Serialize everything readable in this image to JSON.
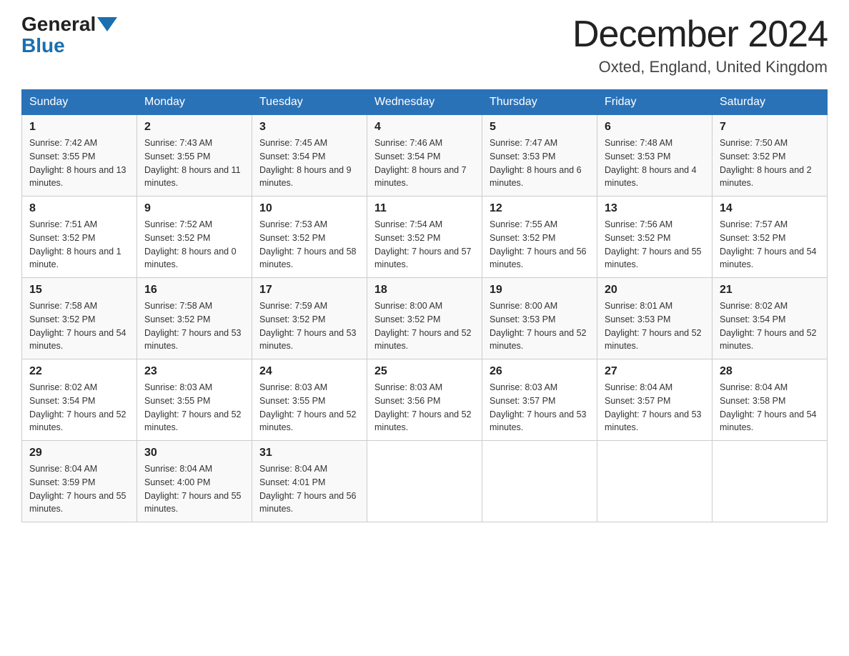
{
  "header": {
    "logo_general": "General",
    "logo_blue": "Blue",
    "month_title": "December 2024",
    "location": "Oxted, England, United Kingdom"
  },
  "days_of_week": [
    "Sunday",
    "Monday",
    "Tuesday",
    "Wednesday",
    "Thursday",
    "Friday",
    "Saturday"
  ],
  "weeks": [
    [
      {
        "day": "1",
        "sunrise": "7:42 AM",
        "sunset": "3:55 PM",
        "daylight": "8 hours and 13 minutes."
      },
      {
        "day": "2",
        "sunrise": "7:43 AM",
        "sunset": "3:55 PM",
        "daylight": "8 hours and 11 minutes."
      },
      {
        "day": "3",
        "sunrise": "7:45 AM",
        "sunset": "3:54 PM",
        "daylight": "8 hours and 9 minutes."
      },
      {
        "day": "4",
        "sunrise": "7:46 AM",
        "sunset": "3:54 PM",
        "daylight": "8 hours and 7 minutes."
      },
      {
        "day": "5",
        "sunrise": "7:47 AM",
        "sunset": "3:53 PM",
        "daylight": "8 hours and 6 minutes."
      },
      {
        "day": "6",
        "sunrise": "7:48 AM",
        "sunset": "3:53 PM",
        "daylight": "8 hours and 4 minutes."
      },
      {
        "day": "7",
        "sunrise": "7:50 AM",
        "sunset": "3:52 PM",
        "daylight": "8 hours and 2 minutes."
      }
    ],
    [
      {
        "day": "8",
        "sunrise": "7:51 AM",
        "sunset": "3:52 PM",
        "daylight": "8 hours and 1 minute."
      },
      {
        "day": "9",
        "sunrise": "7:52 AM",
        "sunset": "3:52 PM",
        "daylight": "8 hours and 0 minutes."
      },
      {
        "day": "10",
        "sunrise": "7:53 AM",
        "sunset": "3:52 PM",
        "daylight": "7 hours and 58 minutes."
      },
      {
        "day": "11",
        "sunrise": "7:54 AM",
        "sunset": "3:52 PM",
        "daylight": "7 hours and 57 minutes."
      },
      {
        "day": "12",
        "sunrise": "7:55 AM",
        "sunset": "3:52 PM",
        "daylight": "7 hours and 56 minutes."
      },
      {
        "day": "13",
        "sunrise": "7:56 AM",
        "sunset": "3:52 PM",
        "daylight": "7 hours and 55 minutes."
      },
      {
        "day": "14",
        "sunrise": "7:57 AM",
        "sunset": "3:52 PM",
        "daylight": "7 hours and 54 minutes."
      }
    ],
    [
      {
        "day": "15",
        "sunrise": "7:58 AM",
        "sunset": "3:52 PM",
        "daylight": "7 hours and 54 minutes."
      },
      {
        "day": "16",
        "sunrise": "7:58 AM",
        "sunset": "3:52 PM",
        "daylight": "7 hours and 53 minutes."
      },
      {
        "day": "17",
        "sunrise": "7:59 AM",
        "sunset": "3:52 PM",
        "daylight": "7 hours and 53 minutes."
      },
      {
        "day": "18",
        "sunrise": "8:00 AM",
        "sunset": "3:52 PM",
        "daylight": "7 hours and 52 minutes."
      },
      {
        "day": "19",
        "sunrise": "8:00 AM",
        "sunset": "3:53 PM",
        "daylight": "7 hours and 52 minutes."
      },
      {
        "day": "20",
        "sunrise": "8:01 AM",
        "sunset": "3:53 PM",
        "daylight": "7 hours and 52 minutes."
      },
      {
        "day": "21",
        "sunrise": "8:02 AM",
        "sunset": "3:54 PM",
        "daylight": "7 hours and 52 minutes."
      }
    ],
    [
      {
        "day": "22",
        "sunrise": "8:02 AM",
        "sunset": "3:54 PM",
        "daylight": "7 hours and 52 minutes."
      },
      {
        "day": "23",
        "sunrise": "8:03 AM",
        "sunset": "3:55 PM",
        "daylight": "7 hours and 52 minutes."
      },
      {
        "day": "24",
        "sunrise": "8:03 AM",
        "sunset": "3:55 PM",
        "daylight": "7 hours and 52 minutes."
      },
      {
        "day": "25",
        "sunrise": "8:03 AM",
        "sunset": "3:56 PM",
        "daylight": "7 hours and 52 minutes."
      },
      {
        "day": "26",
        "sunrise": "8:03 AM",
        "sunset": "3:57 PM",
        "daylight": "7 hours and 53 minutes."
      },
      {
        "day": "27",
        "sunrise": "8:04 AM",
        "sunset": "3:57 PM",
        "daylight": "7 hours and 53 minutes."
      },
      {
        "day": "28",
        "sunrise": "8:04 AM",
        "sunset": "3:58 PM",
        "daylight": "7 hours and 54 minutes."
      }
    ],
    [
      {
        "day": "29",
        "sunrise": "8:04 AM",
        "sunset": "3:59 PM",
        "daylight": "7 hours and 55 minutes."
      },
      {
        "day": "30",
        "sunrise": "8:04 AM",
        "sunset": "4:00 PM",
        "daylight": "7 hours and 55 minutes."
      },
      {
        "day": "31",
        "sunrise": "8:04 AM",
        "sunset": "4:01 PM",
        "daylight": "7 hours and 56 minutes."
      },
      null,
      null,
      null,
      null
    ]
  ]
}
